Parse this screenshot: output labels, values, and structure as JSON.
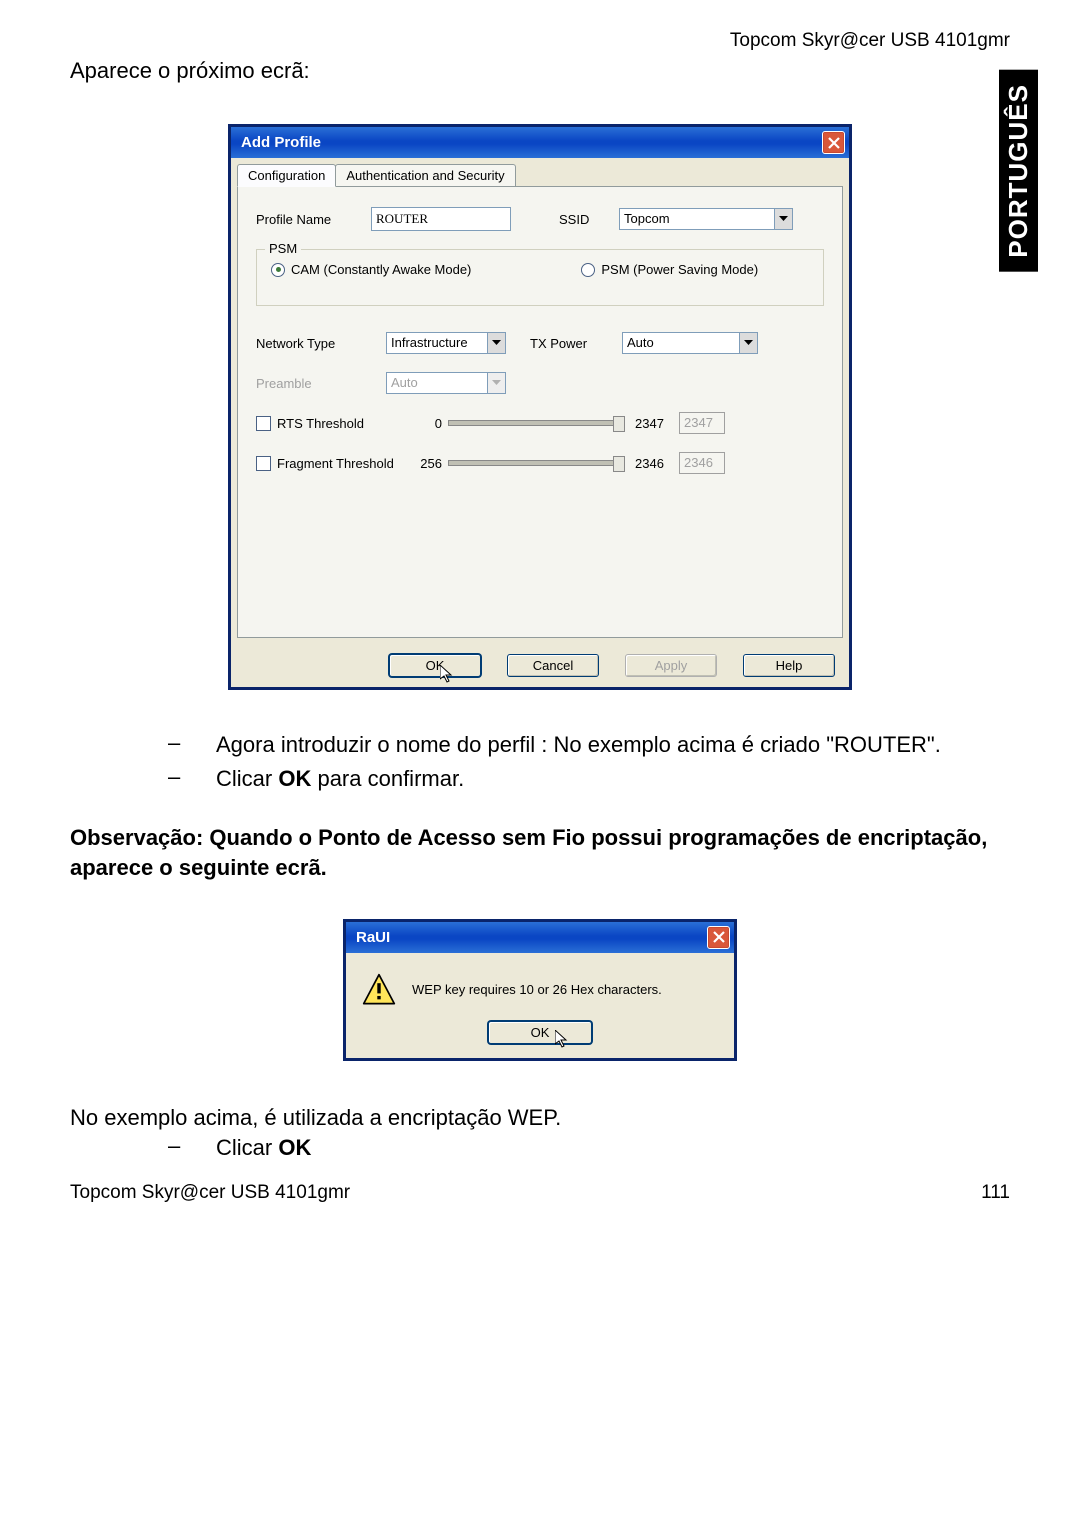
{
  "header": {
    "product": "Topcom Skyr@cer USB 4101gmr"
  },
  "side_tab": "PORTUGUÊS",
  "intro": "Aparece o próximo ecrã:",
  "dialog": {
    "title": "Add Profile",
    "tabs": {
      "config": "Configuration",
      "auth": "Authentication and Security"
    },
    "profile_name_label": "Profile Name",
    "profile_name_value": "ROUTER",
    "ssid_label": "SSID",
    "ssid_value": "Topcom",
    "psm_legend": "PSM",
    "radio_cam": "CAM (Constantly Awake Mode)",
    "radio_psm": "PSM (Power Saving Mode)",
    "network_type_label": "Network Type",
    "network_type_value": "Infrastructure",
    "tx_power_label": "TX Power",
    "tx_power_value": "Auto",
    "preamble_label": "Preamble",
    "preamble_value": "Auto",
    "rts_label": "RTS Threshold",
    "rts_min": "0",
    "rts_max": "2347",
    "rts_value": "2347",
    "frag_label": "Fragment Threshold",
    "frag_min": "256",
    "frag_max": "2346",
    "frag_value": "2346",
    "btn_ok": "OK",
    "btn_cancel": "Cancel",
    "btn_apply": "Apply",
    "btn_help": "Help"
  },
  "bullet1": "Agora introduzir o nome do perfil : No exemplo acima é criado \"ROUTER\".",
  "bullet2_pre": "Clicar ",
  "bullet2_bold": "OK",
  "bullet2_post": " para confirmar.",
  "note": "Observação: Quando o Ponto de Acesso sem Fio possui programações de encriptação, aparece o seguinte ecrã.",
  "small_dialog": {
    "title": "RaUI",
    "message": "WEP key requires 10 or 26 Hex characters.",
    "ok": "OK"
  },
  "after": "No exemplo acima, é utilizada a encriptação WEP.",
  "bullet3_pre": "Clicar ",
  "bullet3_bold": "OK",
  "footer": {
    "left": "Topcom Skyr@cer USB 4101gmr",
    "right": "111"
  }
}
